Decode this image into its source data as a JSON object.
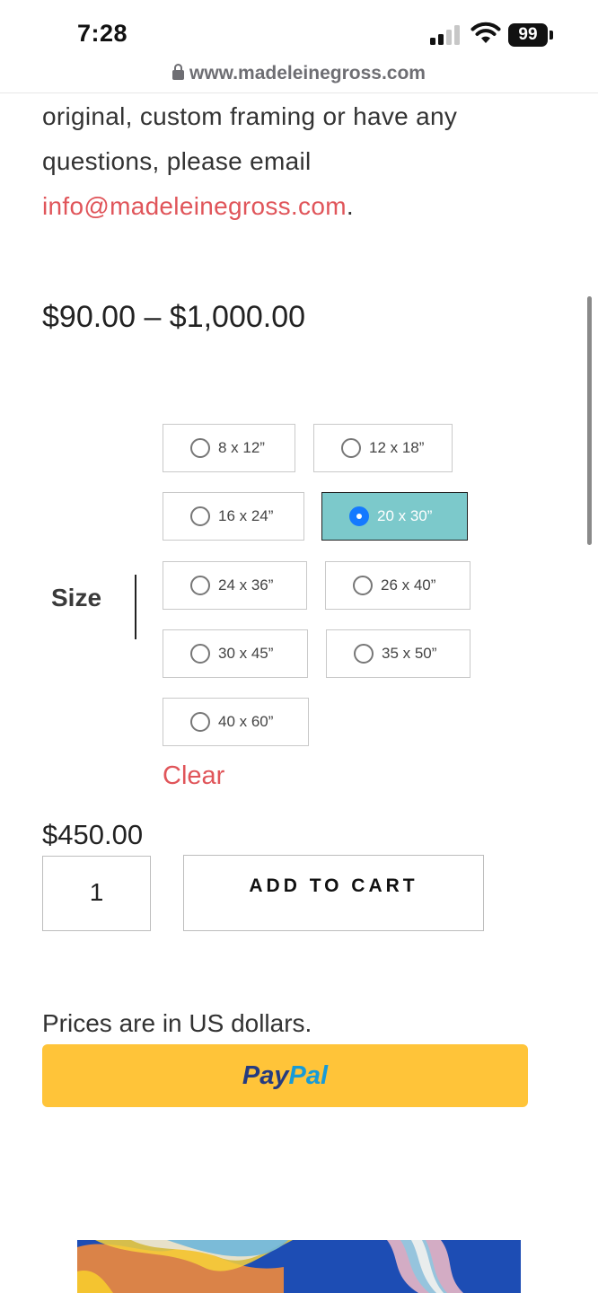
{
  "status_bar": {
    "time": "7:28",
    "battery": "99"
  },
  "browser": {
    "url": "www.madeleinegross.com"
  },
  "description": {
    "line1": "original, custom framing or have any",
    "line2": "questions, please email",
    "email": "info@madeleinegross.com",
    "email_suffix": "."
  },
  "product": {
    "price_range": "$90.00 – $1,000.00",
    "size_label": "Size",
    "sizes": [
      {
        "label": "8 x 12”",
        "selected": false
      },
      {
        "label": "12 x 18”",
        "selected": false
      },
      {
        "label": "16 x 24”",
        "selected": false
      },
      {
        "label": "20 x 30”",
        "selected": true
      },
      {
        "label": "24 x 36”",
        "selected": false
      },
      {
        "label": "26 x 40”",
        "selected": false
      },
      {
        "label": "30 x 45”",
        "selected": false
      },
      {
        "label": "35 x 50”",
        "selected": false
      },
      {
        "label": "40 x 60”",
        "selected": false
      }
    ],
    "clear_label": "Clear",
    "variant_price": "$450.00",
    "quantity": "1",
    "add_to_cart_label": "ADD TO CART",
    "currency_note": "Prices are in US dollars.",
    "paypal": {
      "pay": "Pay",
      "pal": "Pal"
    }
  },
  "colors": {
    "accent_link": "#e0555a",
    "selected_option_bg": "#7cc9cb",
    "radio_selected": "#1479ff",
    "paypal_yellow": "#ffc439"
  }
}
